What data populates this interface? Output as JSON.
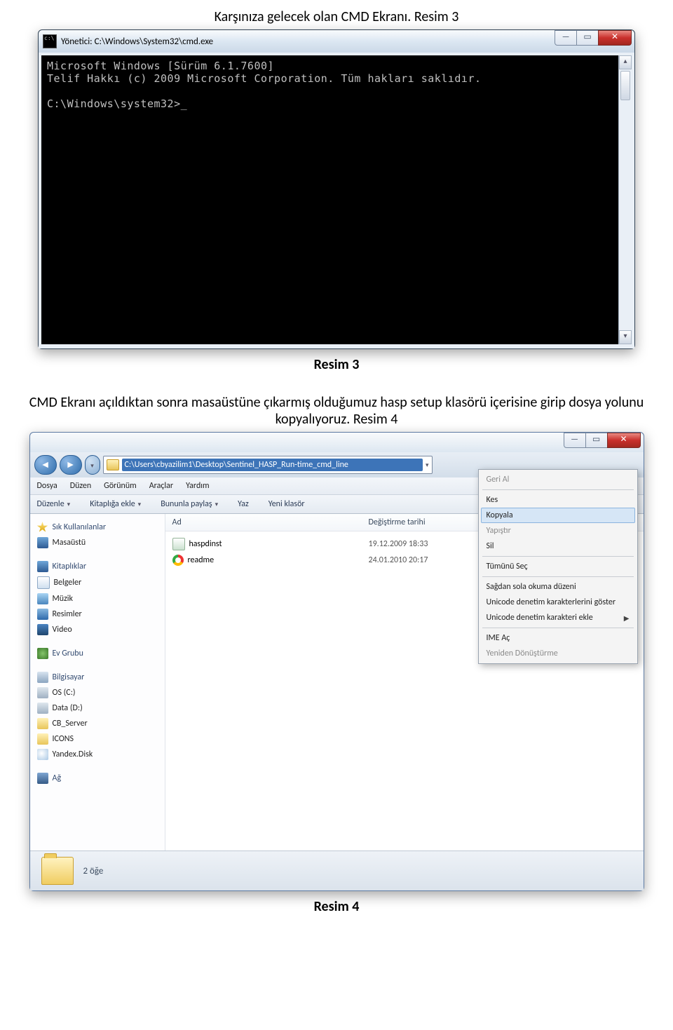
{
  "doc": {
    "line1": "Karşınıza gelecek olan CMD Ekranı. Resim 3",
    "caption1": "Resim 3",
    "line2": "CMD Ekranı açıldıktan sonra masaüstüne çıkarmış olduğumuz hasp setup klasörü içerisine girip dosya yolunu kopyalıyoruz. Resim 4",
    "caption2": "Resim 4"
  },
  "cmd": {
    "title": "Yönetici: C:\\Windows\\System32\\cmd.exe",
    "icon_text": "c:\\",
    "body": "Microsoft Windows [Sürüm 6.1.7600]\nTelif Hakkı (c) 2009 Microsoft Corporation. Tüm hakları saklıdır.\n\nC:\\Windows\\system32>_"
  },
  "win_controls": {
    "min": "—",
    "max": "▭",
    "close": "✕"
  },
  "explorer": {
    "address_path": "C:\\Users\\cbyazilim1\\Desktop\\Sentinel_HASP_Run-time_cmd_line",
    "menu": {
      "file": "Dosya",
      "edit": "Düzen",
      "view": "Görünüm",
      "tools": "Araçlar",
      "help": "Yardım"
    },
    "toolbar": {
      "organize": "Düzenle",
      "add_library": "Kitaplığa ekle",
      "share": "Bununla paylaş",
      "burn": "Yaz",
      "newfolder": "Yeni klasör"
    },
    "columns": {
      "name": "Ad",
      "date": "Değiştirme tarihi"
    },
    "files": [
      {
        "name": "haspdinst",
        "date": "19.12.2009 18:33",
        "icon": "app"
      },
      {
        "name": "readme",
        "date": "24.01.2010 20:17",
        "icon": "chrome"
      }
    ],
    "sidebar": {
      "favorites": "Sık Kullanılanlar",
      "desktop": "Masaüstü",
      "libraries": "Kitaplıklar",
      "documents": "Belgeler",
      "music": "Müzik",
      "pictures": "Resimler",
      "video": "Video",
      "homegroup": "Ev Grubu",
      "computer": "Bilgisayar",
      "drive_c": "OS (C:)",
      "drive_d": "Data (D:)",
      "cbserver": "CB_Server",
      "icons": "ICONS",
      "yandex": "Yandex.Disk",
      "network": "Ağ"
    },
    "status": "2 öğe",
    "context_menu": {
      "undo": "Geri Al",
      "cut": "Kes",
      "copy": "Kopyala",
      "paste": "Yapıştır",
      "delete": "Sil",
      "selectall": "Tümünü Seç",
      "rtl": "Sağdan sola okuma düzeni",
      "show_unicode": "Unicode denetim karakterlerini göster",
      "insert_unicode": "Unicode denetim karakteri ekle",
      "ime": "IME Aç",
      "reconvert": "Yeniden Dönüştürme"
    }
  }
}
